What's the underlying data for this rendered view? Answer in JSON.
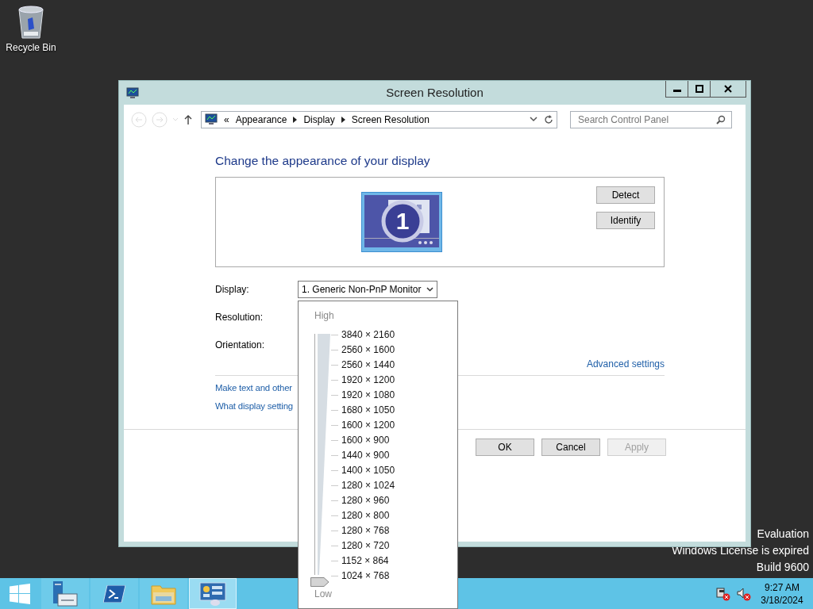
{
  "desktop": {
    "icons": [
      {
        "label": "Recycle Bin"
      }
    ],
    "watermark": [
      "Evaluation",
      "Windows License is expired",
      "Build 9600"
    ]
  },
  "window": {
    "title": "Screen Resolution",
    "breadcrumb": {
      "overflow": "«",
      "items": [
        "Appearance",
        "Display",
        "Screen Resolution"
      ]
    },
    "search": {
      "placeholder": "Search Control Panel"
    },
    "heading": "Change the appearance of your display",
    "monitor_badge": "1",
    "preview_buttons": [
      "Detect",
      "Identify"
    ],
    "fields": [
      {
        "label": "Display:",
        "value": "1. Generic Non-PnP Monitor"
      },
      {
        "label": "Resolution:"
      },
      {
        "label": "Orientation:"
      }
    ],
    "advanced_link": "Advanced settings",
    "links": [
      "Make text and other",
      "What display setting"
    ],
    "buttons": [
      {
        "label": "OK",
        "disabled": false
      },
      {
        "label": "Cancel",
        "disabled": false
      },
      {
        "label": "Apply",
        "disabled": true
      }
    ]
  },
  "resolution_popup": {
    "high_label": "High",
    "low_label": "Low",
    "level": 0,
    "options": [
      "3840 × 2160",
      "2560 × 1600",
      "2560 × 1440",
      "1920 × 1200",
      "1920 × 1080",
      "1680 × 1050",
      "1600 × 1200",
      "1600 × 900",
      "1440 × 900",
      "1400 × 1050",
      "1280 × 1024",
      "1280 × 960",
      "1280 × 800",
      "1280 × 768",
      "1280 × 720",
      "1152 × 864",
      "1024 × 768"
    ]
  },
  "taskbar": {
    "items": [
      {
        "kind": "start",
        "selected": false
      },
      {
        "kind": "server-manager",
        "selected": false
      },
      {
        "kind": "powershell",
        "selected": false
      },
      {
        "kind": "explorer",
        "selected": false
      },
      {
        "kind": "control-panel",
        "selected": true
      }
    ],
    "clock": {
      "time": "9:27 AM",
      "date": "3/18/2024"
    }
  }
}
